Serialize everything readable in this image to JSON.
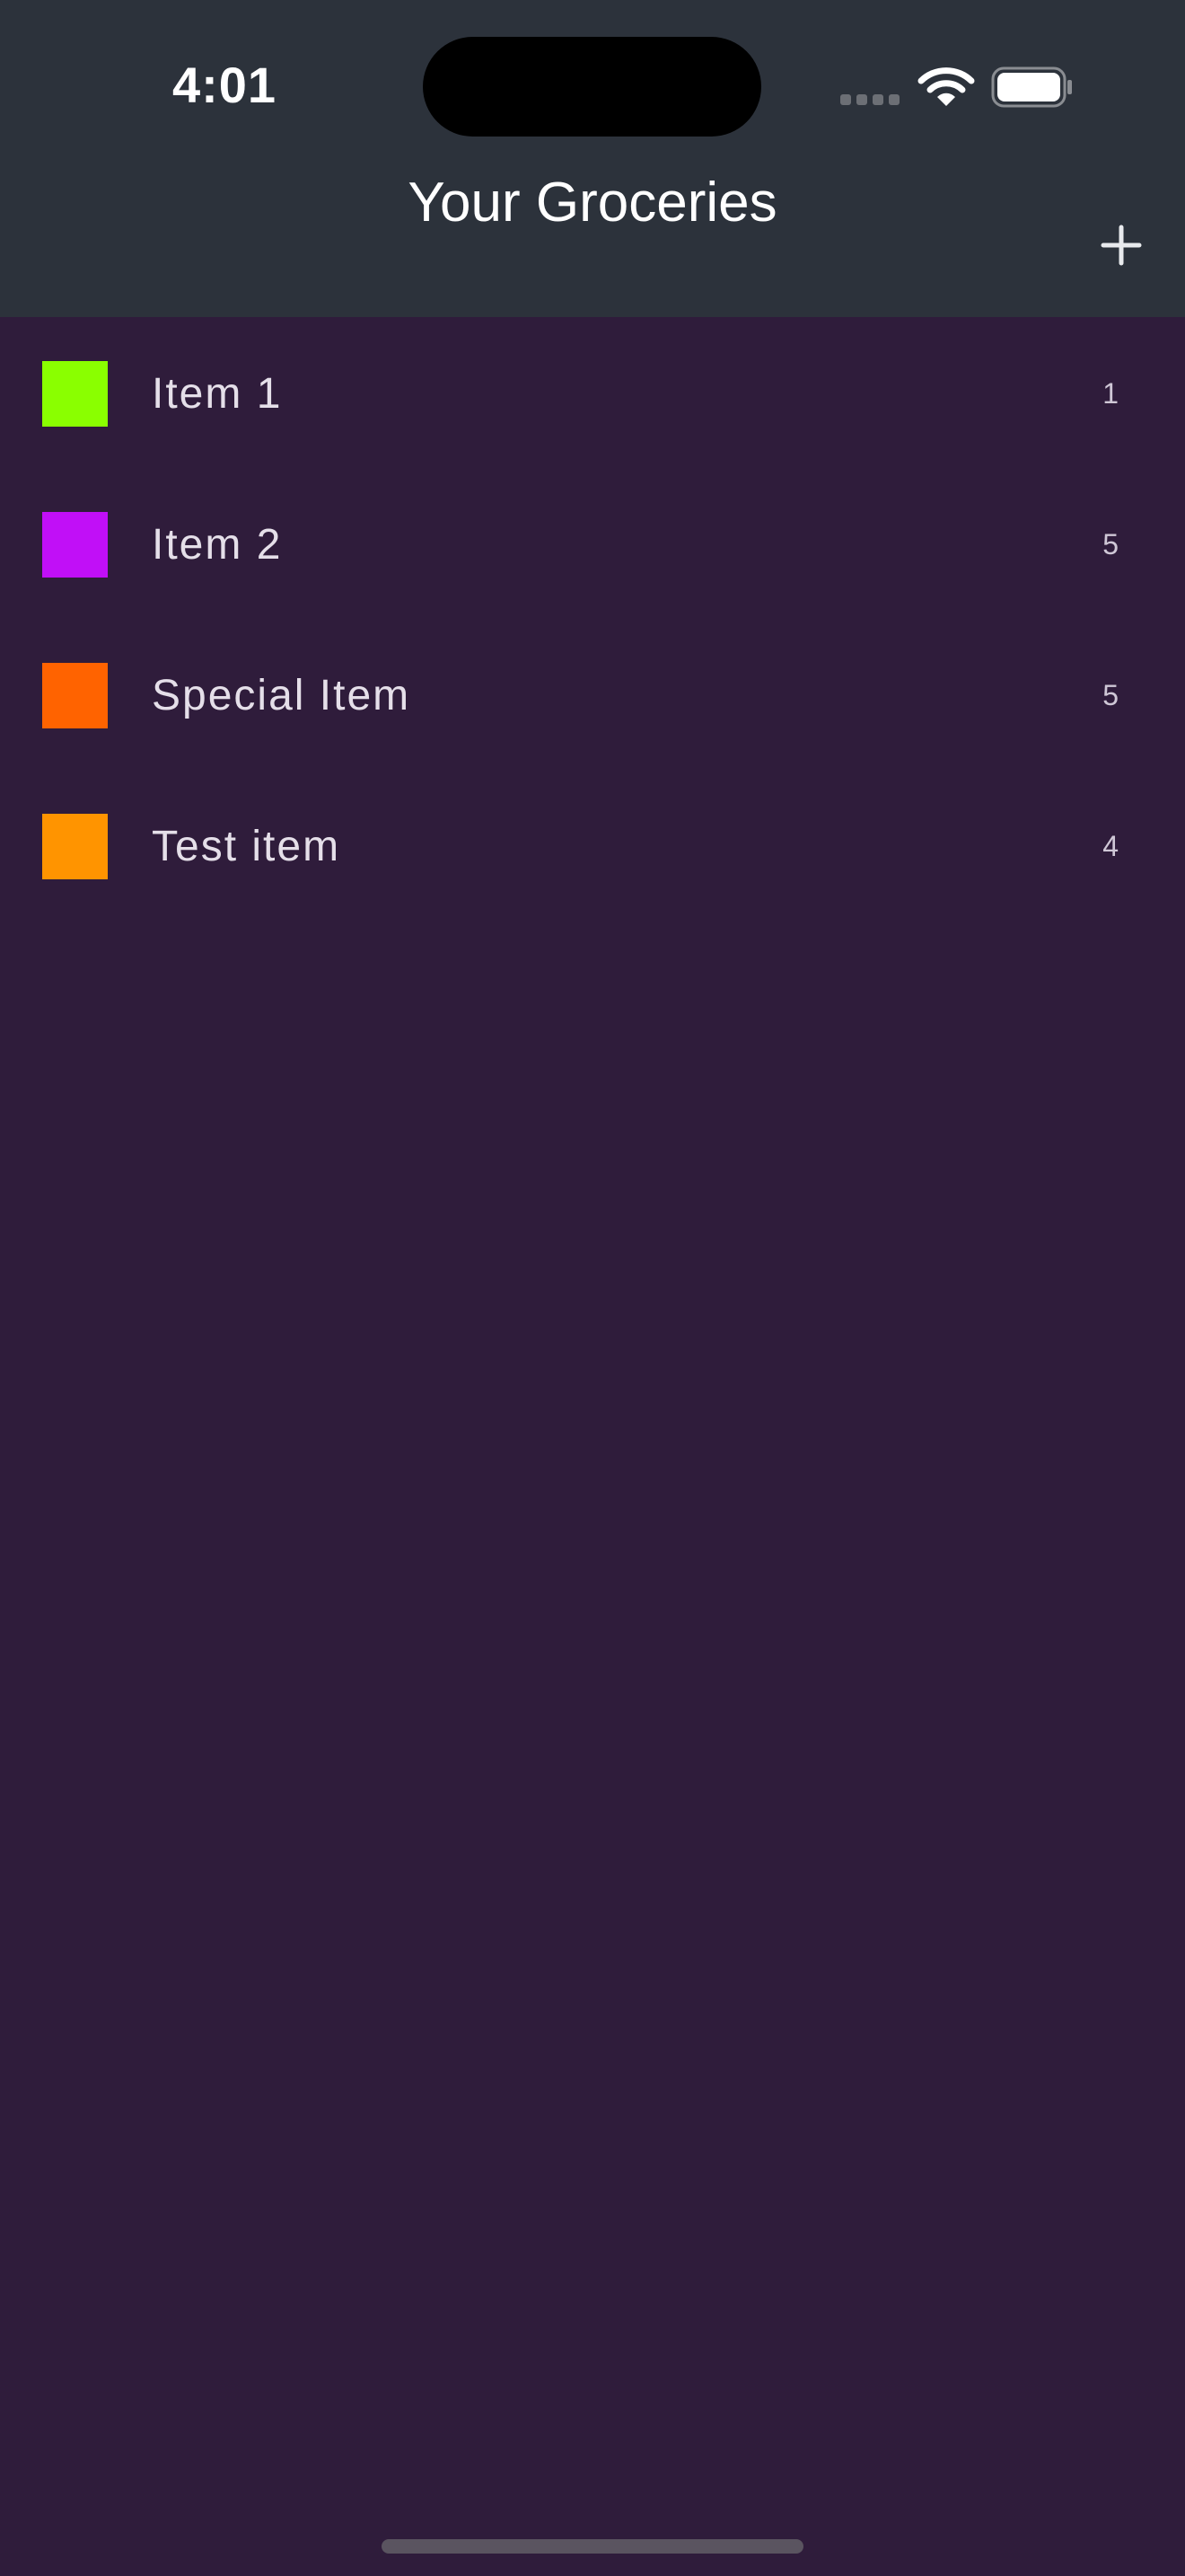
{
  "status_bar": {
    "time": "4:01"
  },
  "nav": {
    "title": "Your Groceries",
    "add_icon": "plus-icon"
  },
  "items": [
    {
      "name": "Item 1",
      "quantity": "1",
      "color": "#8aff00"
    },
    {
      "name": "Item 2",
      "quantity": "5",
      "color": "#c10ff7"
    },
    {
      "name": "Special Item",
      "quantity": "5",
      "color": "#ff6300"
    },
    {
      "name": "Test item",
      "quantity": "4",
      "color": "#ff9400"
    }
  ],
  "colors": {
    "background": "#2f1c3b",
    "header": "#2c323b"
  }
}
